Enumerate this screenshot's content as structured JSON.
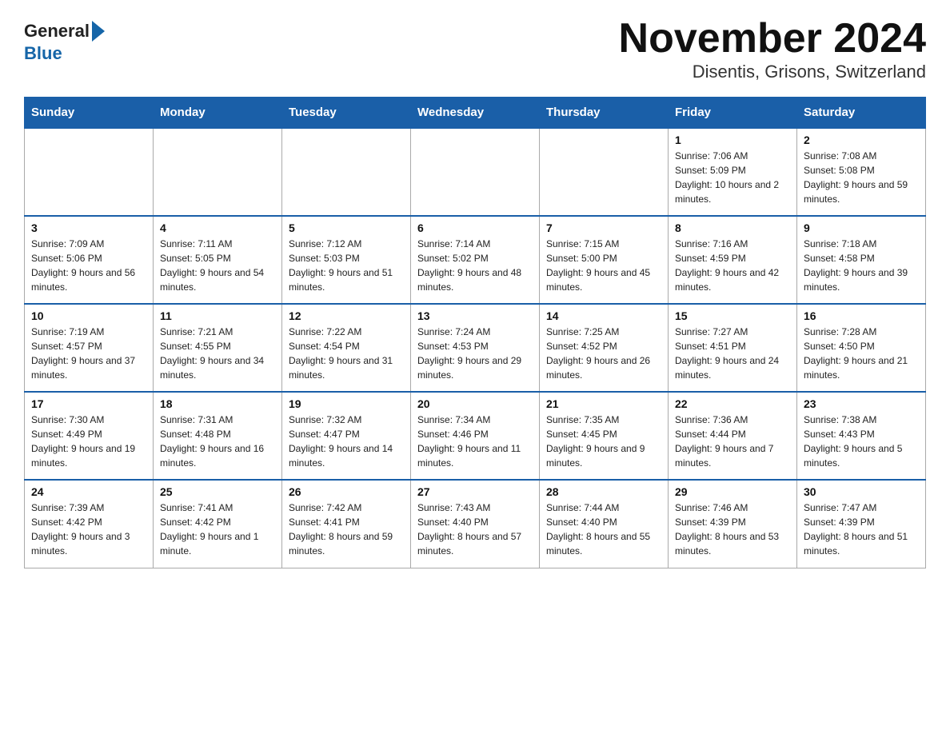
{
  "logo": {
    "general": "General",
    "blue": "Blue",
    "triangle": "▶"
  },
  "title": "November 2024",
  "subtitle": "Disentis, Grisons, Switzerland",
  "days_of_week": [
    "Sunday",
    "Monday",
    "Tuesday",
    "Wednesday",
    "Thursday",
    "Friday",
    "Saturday"
  ],
  "weeks": [
    [
      {
        "day": "",
        "info": ""
      },
      {
        "day": "",
        "info": ""
      },
      {
        "day": "",
        "info": ""
      },
      {
        "day": "",
        "info": ""
      },
      {
        "day": "",
        "info": ""
      },
      {
        "day": "1",
        "info": "Sunrise: 7:06 AM\nSunset: 5:09 PM\nDaylight: 10 hours and 2 minutes."
      },
      {
        "day": "2",
        "info": "Sunrise: 7:08 AM\nSunset: 5:08 PM\nDaylight: 9 hours and 59 minutes."
      }
    ],
    [
      {
        "day": "3",
        "info": "Sunrise: 7:09 AM\nSunset: 5:06 PM\nDaylight: 9 hours and 56 minutes."
      },
      {
        "day": "4",
        "info": "Sunrise: 7:11 AM\nSunset: 5:05 PM\nDaylight: 9 hours and 54 minutes."
      },
      {
        "day": "5",
        "info": "Sunrise: 7:12 AM\nSunset: 5:03 PM\nDaylight: 9 hours and 51 minutes."
      },
      {
        "day": "6",
        "info": "Sunrise: 7:14 AM\nSunset: 5:02 PM\nDaylight: 9 hours and 48 minutes."
      },
      {
        "day": "7",
        "info": "Sunrise: 7:15 AM\nSunset: 5:00 PM\nDaylight: 9 hours and 45 minutes."
      },
      {
        "day": "8",
        "info": "Sunrise: 7:16 AM\nSunset: 4:59 PM\nDaylight: 9 hours and 42 minutes."
      },
      {
        "day": "9",
        "info": "Sunrise: 7:18 AM\nSunset: 4:58 PM\nDaylight: 9 hours and 39 minutes."
      }
    ],
    [
      {
        "day": "10",
        "info": "Sunrise: 7:19 AM\nSunset: 4:57 PM\nDaylight: 9 hours and 37 minutes."
      },
      {
        "day": "11",
        "info": "Sunrise: 7:21 AM\nSunset: 4:55 PM\nDaylight: 9 hours and 34 minutes."
      },
      {
        "day": "12",
        "info": "Sunrise: 7:22 AM\nSunset: 4:54 PM\nDaylight: 9 hours and 31 minutes."
      },
      {
        "day": "13",
        "info": "Sunrise: 7:24 AM\nSunset: 4:53 PM\nDaylight: 9 hours and 29 minutes."
      },
      {
        "day": "14",
        "info": "Sunrise: 7:25 AM\nSunset: 4:52 PM\nDaylight: 9 hours and 26 minutes."
      },
      {
        "day": "15",
        "info": "Sunrise: 7:27 AM\nSunset: 4:51 PM\nDaylight: 9 hours and 24 minutes."
      },
      {
        "day": "16",
        "info": "Sunrise: 7:28 AM\nSunset: 4:50 PM\nDaylight: 9 hours and 21 minutes."
      }
    ],
    [
      {
        "day": "17",
        "info": "Sunrise: 7:30 AM\nSunset: 4:49 PM\nDaylight: 9 hours and 19 minutes."
      },
      {
        "day": "18",
        "info": "Sunrise: 7:31 AM\nSunset: 4:48 PM\nDaylight: 9 hours and 16 minutes."
      },
      {
        "day": "19",
        "info": "Sunrise: 7:32 AM\nSunset: 4:47 PM\nDaylight: 9 hours and 14 minutes."
      },
      {
        "day": "20",
        "info": "Sunrise: 7:34 AM\nSunset: 4:46 PM\nDaylight: 9 hours and 11 minutes."
      },
      {
        "day": "21",
        "info": "Sunrise: 7:35 AM\nSunset: 4:45 PM\nDaylight: 9 hours and 9 minutes."
      },
      {
        "day": "22",
        "info": "Sunrise: 7:36 AM\nSunset: 4:44 PM\nDaylight: 9 hours and 7 minutes."
      },
      {
        "day": "23",
        "info": "Sunrise: 7:38 AM\nSunset: 4:43 PM\nDaylight: 9 hours and 5 minutes."
      }
    ],
    [
      {
        "day": "24",
        "info": "Sunrise: 7:39 AM\nSunset: 4:42 PM\nDaylight: 9 hours and 3 minutes."
      },
      {
        "day": "25",
        "info": "Sunrise: 7:41 AM\nSunset: 4:42 PM\nDaylight: 9 hours and 1 minute."
      },
      {
        "day": "26",
        "info": "Sunrise: 7:42 AM\nSunset: 4:41 PM\nDaylight: 8 hours and 59 minutes."
      },
      {
        "day": "27",
        "info": "Sunrise: 7:43 AM\nSunset: 4:40 PM\nDaylight: 8 hours and 57 minutes."
      },
      {
        "day": "28",
        "info": "Sunrise: 7:44 AM\nSunset: 4:40 PM\nDaylight: 8 hours and 55 minutes."
      },
      {
        "day": "29",
        "info": "Sunrise: 7:46 AM\nSunset: 4:39 PM\nDaylight: 8 hours and 53 minutes."
      },
      {
        "day": "30",
        "info": "Sunrise: 7:47 AM\nSunset: 4:39 PM\nDaylight: 8 hours and 51 minutes."
      }
    ]
  ]
}
